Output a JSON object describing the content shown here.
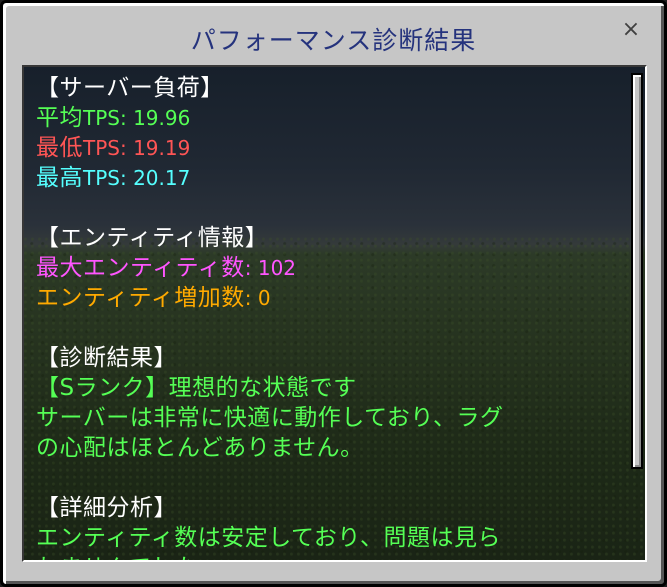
{
  "window": {
    "title": "パフォーマンス診断結果",
    "close_glyph": "×"
  },
  "colors": {
    "heading": "#ffffff",
    "average": "#55ff55",
    "min": "#ff5555",
    "max": "#55ffff",
    "max_entities": "#ff55ff",
    "entity_growth": "#ffaa00",
    "diagnosis": "#55ff55"
  },
  "server_load": {
    "heading": "【サーバー負荷】",
    "average_label": "平均",
    "average_value": "TPS: 19.96",
    "min_label": "最低",
    "min_value": "TPS: 19.19",
    "max_label": "最高",
    "max_value": "TPS: 20.17"
  },
  "entity_info": {
    "heading": "【エンティティ情報】",
    "max_label": "最大エンティティ数",
    "max_value": ": 102",
    "growth_label": "エンティティ増加数",
    "growth_value": ": 0"
  },
  "diagnosis": {
    "heading": "【診断結果】",
    "rank_line": "【Sランク】理想的な状態です",
    "detail_line1": "サーバーは非常に快適に動作しており、ラグ",
    "detail_line2": "の心配はほとんどありません。"
  },
  "analysis": {
    "heading": "【詳細分析】",
    "line1": "エンティティ数は安定しており、問題は見ら",
    "line2": "れませんでした。"
  }
}
